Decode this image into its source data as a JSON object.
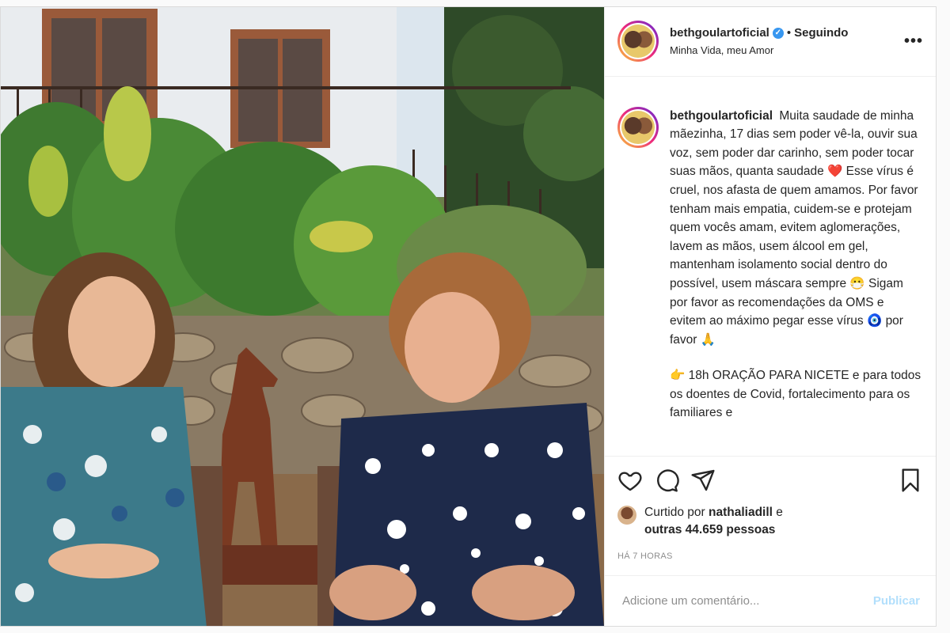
{
  "header": {
    "username": "bethgoulartoficial",
    "dot": "•",
    "follow_status": "Seguindo",
    "location": "Minha Vida, meu Amor",
    "more": "•••"
  },
  "caption": {
    "username": "bethgoulartoficial",
    "paragraph1": "Muita saudade de minha mãezinha, 17 dias sem poder vê-la, ouvir sua voz, sem poder dar carinho, sem poder tocar suas mãos, quanta saudade ❤️ Esse vírus é cruel, nos afasta de quem amamos. Por favor tenham mais empatia, cuidem-se e protejam quem vocês amam, evitem aglomerações, lavem as mãos, usem álcool em gel, mantenham isolamento social dentro do possível, usem máscara sempre 😷 Sigam por favor as recomendações da OMS e evitem ao máximo pegar esse vírus 🧿 por favor 🙏",
    "paragraph2": "👉 18h ORAÇÃO PARA NICETE e para todos os doentes de Covid, fortalecimento para os familiares e"
  },
  "likes": {
    "prefix": "Curtido por",
    "user": "nathaliadill",
    "conj": "e",
    "others": "outras 44.659 pessoas"
  },
  "timestamp": "HÁ 7 HORAS",
  "comment": {
    "placeholder": "Adicione um comentário...",
    "publish": "Publicar"
  },
  "colors": {
    "verified": "#3897f0",
    "publish_disabled": "#b2dffc",
    "text": "#262626",
    "muted": "#8e8e8e"
  },
  "icons": [
    "heart-icon",
    "comment-icon",
    "share-icon",
    "bookmark-icon",
    "verified-icon",
    "more-icon"
  ]
}
